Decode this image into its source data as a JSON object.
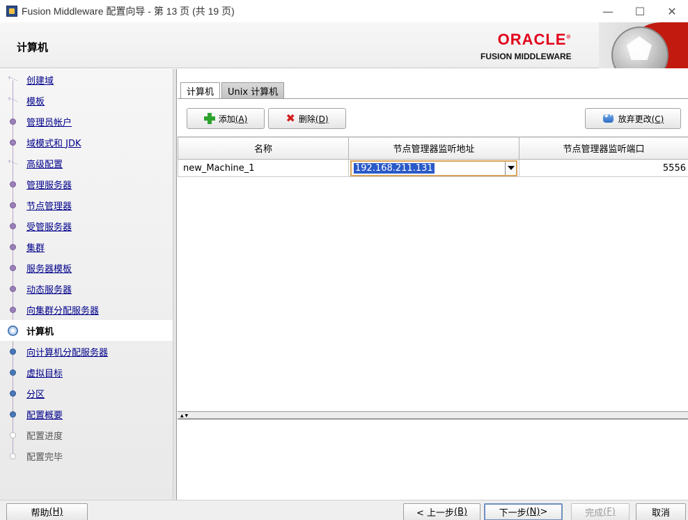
{
  "window": {
    "title": "Fusion Middleware 配置向导 - 第 13 页 (共 19 页)",
    "minimize": "—",
    "maximize": "☐",
    "close": "✕"
  },
  "header": {
    "page_title": "计算机",
    "logo_oracle": "ORACLE",
    "logo_tm": "®",
    "logo_product": "FUSION MIDDLEWARE"
  },
  "nav": {
    "items": [
      {
        "label": "创建域",
        "state": "done-branch"
      },
      {
        "label": "模板",
        "state": "done-branch"
      },
      {
        "label": "管理员帐户",
        "state": "done"
      },
      {
        "label": "域模式和 JDK",
        "state": "done"
      },
      {
        "label": "高级配置",
        "state": "done-branch"
      },
      {
        "label": "管理服务器",
        "state": "done"
      },
      {
        "label": "节点管理器",
        "state": "done"
      },
      {
        "label": "受管服务器",
        "state": "done"
      },
      {
        "label": "集群",
        "state": "done"
      },
      {
        "label": "服务器模板",
        "state": "done"
      },
      {
        "label": "动态服务器",
        "state": "done"
      },
      {
        "label": "向集群分配服务器",
        "state": "done"
      },
      {
        "label": "计算机",
        "state": "current"
      },
      {
        "label": "向计算机分配服务器",
        "state": "next"
      },
      {
        "label": "虚拟目标",
        "state": "next"
      },
      {
        "label": "分区",
        "state": "next"
      },
      {
        "label": "配置概要",
        "state": "next"
      },
      {
        "label": "配置进度",
        "state": "pending"
      },
      {
        "label": "配置完毕",
        "state": "pending"
      }
    ]
  },
  "tabs": [
    {
      "label": "计算机",
      "active": true
    },
    {
      "label": "Unix 计算机",
      "active": false
    }
  ],
  "toolbar": {
    "add_label": "添加",
    "add_mnemonic": "(A)",
    "delete_label": "删除",
    "delete_mnemonic": "(D)",
    "discard_label": "放弃更改",
    "discard_mnemonic": "(C)"
  },
  "table": {
    "columns": [
      "名称",
      "节点管理器监听地址",
      "节点管理器监听端口"
    ],
    "rows": [
      {
        "name": "new_Machine_1",
        "address": "192.168.211.131",
        "port": "5556"
      }
    ]
  },
  "footer": {
    "help_label": "帮助",
    "help_mnemonic": "(H)",
    "back_label": "< 上一步",
    "back_mnemonic": "(B)",
    "next_label": "下一步",
    "next_mnemonic": "(N)",
    "next_suffix": " >",
    "finish_label": "完成",
    "finish_mnemonic": "(F)",
    "cancel_label": "取消"
  },
  "colors": {
    "link": "#00008b",
    "selection": "#2a5ac8",
    "oracle_red": "#e2001a",
    "focus_border": "#d9a35a"
  }
}
